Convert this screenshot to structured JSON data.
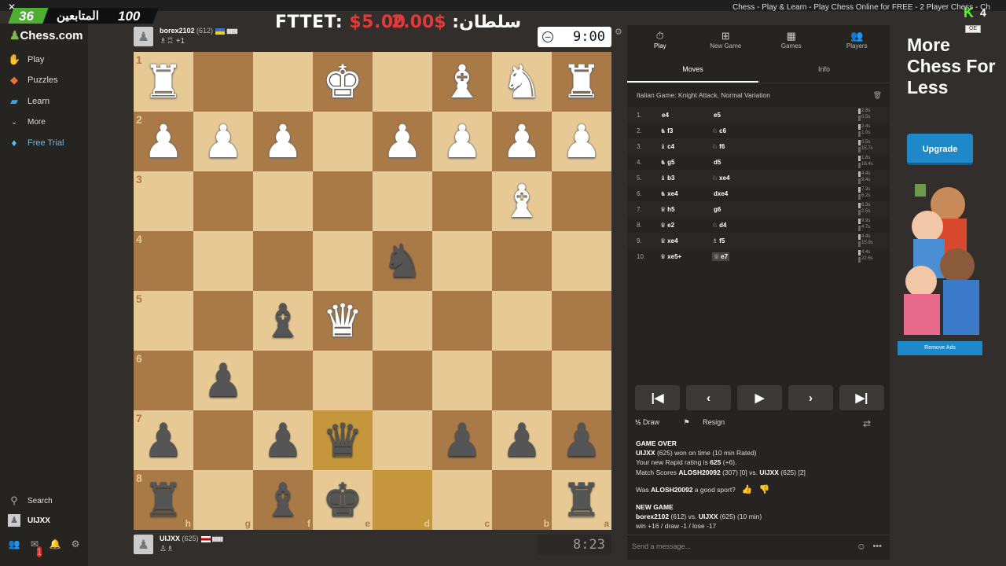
{
  "overlay": {
    "window_title": "Chess - Play & Learn - Play Chess Online for FREE - 2 Player Chess - Chess.com",
    "close_glyph": "✕",
    "followers_count": "36",
    "followers_label": "المتابعين",
    "followers_goal": "100",
    "stake_left_name": "FTTET: ",
    "stake_left_amount": "$5.00",
    "stake_right_amount": "2.00$",
    "stake_right_name": " :سلطان",
    "kick_logo": "K",
    "kick_num": "4",
    "flag_text": "OE"
  },
  "sidebar": {
    "logo": "Chess.com",
    "items": [
      {
        "label": "Play",
        "icon": "play-hand-icon"
      },
      {
        "label": "Puzzles",
        "icon": "puzzle-icon"
      },
      {
        "label": "Learn",
        "icon": "learn-cap-icon"
      },
      {
        "label": "More",
        "icon": "chevron-down-icon"
      },
      {
        "label": "Free Trial",
        "icon": "diamond-icon"
      }
    ],
    "search_label": "Search",
    "user_label": "UIJXX",
    "notif_badge": "1"
  },
  "top_player": {
    "name": "borex2102",
    "rating": "(612)",
    "bars": "▮▮▮▮",
    "captured": "♗♖ +1",
    "clock": "9:00"
  },
  "bottom_player": {
    "name": "UIJXX",
    "rating": "(625)",
    "bars": "▮▮▮▮",
    "captured": "♙♗",
    "clock": "8:23"
  },
  "board": {
    "files": [
      "h",
      "g",
      "f",
      "e",
      "d",
      "c",
      "b",
      "a"
    ],
    "ranks": [
      "1",
      "2",
      "3",
      "4",
      "5",
      "6",
      "7",
      "8"
    ],
    "squares": [
      [
        "wR",
        "",
        "",
        "wK",
        "",
        "wB",
        "wN",
        "wR"
      ],
      [
        "wP",
        "wP",
        "wP",
        "",
        "wP",
        "wP",
        "wP",
        "wP"
      ],
      [
        "",
        "",
        "",
        "",
        "",
        "",
        "wB",
        ""
      ],
      [
        "",
        "",
        "",
        "",
        "bN",
        "",
        "",
        ""
      ],
      [
        "",
        "",
        "bB",
        "wQ",
        "",
        "",
        "",
        ""
      ],
      [
        "",
        "bP",
        "",
        "",
        "",
        "",
        "",
        ""
      ],
      [
        "bP",
        "",
        "bP",
        "bQ",
        "",
        "bP",
        "bP",
        "bP"
      ],
      [
        "bR",
        "",
        "bB",
        "bK",
        "",
        "",
        "",
        "bR"
      ]
    ],
    "highlighted": [
      [
        6,
        3
      ],
      [
        7,
        4
      ]
    ]
  },
  "panel": {
    "tabs": [
      {
        "label": "Play",
        "icon": "stopwatch-icon"
      },
      {
        "label": "New Game",
        "icon": "plus-icon"
      },
      {
        "label": "Games",
        "icon": "board-icon"
      },
      {
        "label": "Players",
        "icon": "players-icon"
      }
    ],
    "subtabs": [
      "Moves",
      "Info"
    ],
    "opening": "Italian Game: Knight Attack, Normal Variation",
    "moves": [
      {
        "n": "1.",
        "wp": "",
        "w": "e4",
        "bp": "",
        "b": "e5",
        "tw": "2.8s",
        "tb": "0.5s"
      },
      {
        "n": "2.",
        "wp": "♞",
        "w": "f3",
        "bp": "♘",
        "b": "c6",
        "tw": "2.4s",
        "tb": "1.0s"
      },
      {
        "n": "3.",
        "wp": "♝",
        "w": "c4",
        "bp": "♘",
        "b": "f6",
        "tw": "0.5s",
        "tb": "15.7s"
      },
      {
        "n": "4.",
        "wp": "♞",
        "w": "g5",
        "bp": "",
        "b": "d5",
        "tw": "1.8s",
        "tb": "18.4s"
      },
      {
        "n": "5.",
        "wp": "♝",
        "w": "b3",
        "bp": "♘",
        "b": "xe4",
        "tw": "4.4s",
        "tb": "9.4s"
      },
      {
        "n": "6.",
        "wp": "♞",
        "w": "xe4",
        "bp": "",
        "b": "dxe4",
        "tw": "7.3s",
        "tb": "6.2s"
      },
      {
        "n": "7.",
        "wp": "♛",
        "w": "h5",
        "bp": "",
        "b": "g6",
        "tw": "6.3s",
        "tb": "2.5s"
      },
      {
        "n": "8.",
        "wp": "♛",
        "w": "e2",
        "bp": "♘",
        "b": "d4",
        "tw": "9.9s",
        "tb": "4.7s"
      },
      {
        "n": "9.",
        "wp": "♛",
        "w": "xe4",
        "bp": "♗",
        "b": "f5",
        "tw": "4.4s",
        "tb": "15.9s"
      },
      {
        "n": "10.",
        "wp": "♛",
        "w": "xe5+",
        "bp": "♕",
        "b": "e7",
        "tw": "4.4s",
        "tb": "22.6s"
      }
    ],
    "nav": {
      "first": "|◀",
      "prev": "‹",
      "play": "▶",
      "next": "›",
      "last": "▶|"
    },
    "draw_label": "Draw",
    "draw_icon": "½",
    "resign_label": "Resign",
    "log": {
      "game_over": "GAME OVER",
      "line1_name": "UIJXX",
      "line1_rest": " (625) won on time (10 min Rated)",
      "line2_pre": "Your new Rapid rating is ",
      "line2_val": "625",
      "line2_post": " (+6).",
      "line3_pre": "Match Scores ",
      "line3_a": "ALOSH20092",
      "line3_mid": " (307) [0] vs. ",
      "line3_b": "UIJXX",
      "line3_post": " (625) [2]",
      "sport_pre": "Was ",
      "sport_name": "ALOSH20092",
      "sport_post": " a good sport?",
      "new_game": "NEW GAME",
      "ng_a": "borex2102",
      "ng_mid": " (612) vs. ",
      "ng_b": "UIJXX",
      "ng_post": " (625) (10 min)",
      "ng_stats": "win +16 / draw -1 / lose -17"
    },
    "message_placeholder": "Send a message..."
  },
  "ad": {
    "title": "More Chess For Less",
    "upgrade": "Upgrade",
    "remove": "Remove Ads"
  }
}
